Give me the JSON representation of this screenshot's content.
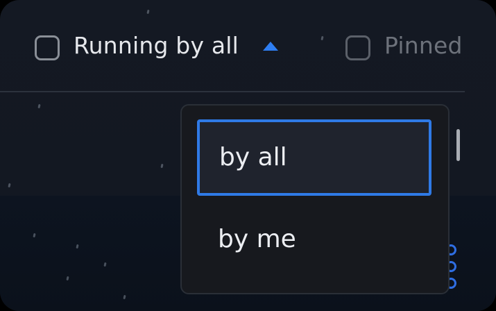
{
  "filter_bar": {
    "running": {
      "label": "Running by all",
      "checked": false
    },
    "sort_caret_icon": "caret-up-icon",
    "pinned": {
      "label": "Pinned",
      "checked": false
    }
  },
  "dropdown": {
    "options": [
      {
        "label": "by all",
        "selected": true
      },
      {
        "label": "by me",
        "selected": false
      }
    ]
  },
  "icons": {
    "more": "more-vertical-icon"
  },
  "colors": {
    "accent": "#2f7ae6",
    "background": "#141923",
    "dropdown_bg": "#17191e",
    "text_primary": "#e6e8ec",
    "text_muted": "#6d727b"
  }
}
